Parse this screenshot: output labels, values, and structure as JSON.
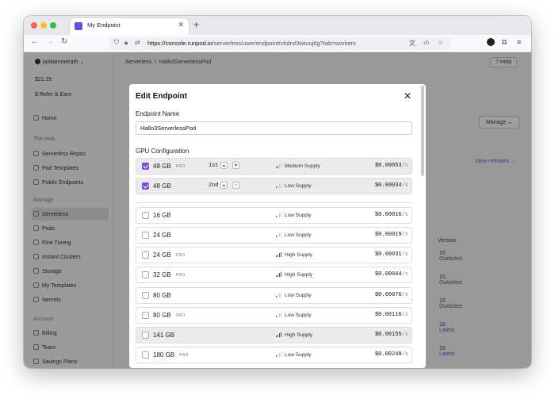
{
  "browser": {
    "tab_title": "My Endpoint",
    "url_domain": "https://console.runpod.io",
    "url_path": "/serverless/user/endpoint/vhdrvl3wtuuj6g?tab=workers"
  },
  "sidebar": {
    "user": "jankammerath",
    "balance": "$21.25",
    "refer": "Refer & Earn",
    "home": "Home",
    "hub_header": "The Hub",
    "hub_items": [
      "Serverless Repos",
      "Pod Templates",
      "Public Endpoints"
    ],
    "manage_header": "Manage",
    "manage_items": [
      "Serverless",
      "Pods",
      "Fine Tuning",
      "Instant Clusters",
      "Storage",
      "My Templates",
      "Secrets"
    ],
    "account_header": "Account",
    "account_items": [
      "Billing",
      "Team",
      "Savings Plans"
    ]
  },
  "background": {
    "breadcrumb_root": "Serverless",
    "breadcrumb_current": "Hallo3ServerlessPod",
    "help": "Help",
    "manage": "Manage",
    "view_releases": "View releases",
    "version_header": "Version",
    "rows": [
      {
        "version": "15",
        "status": "Outdated"
      },
      {
        "version": "15",
        "status": "Outdated"
      },
      {
        "version": "15",
        "status": "Outdated"
      },
      {
        "version": "16",
        "status": "Latest"
      },
      {
        "version": "16",
        "status": "Latest"
      }
    ]
  },
  "modal": {
    "title": "Edit Endpoint",
    "endpoint_name_label": "Endpoint Name",
    "endpoint_name_value": "Hallo3ServerlessPod",
    "gpu_config_label": "GPU Configuration",
    "selected_gpus": [
      {
        "memory": "48 GB",
        "pro": "PRO",
        "priority": "1st",
        "supply": "Medium Supply",
        "price": "$0.00053",
        "unit": "/s",
        "checked": true
      },
      {
        "memory": "48 GB",
        "pro": "",
        "priority": "2nd",
        "supply": "Low Supply",
        "price": "$0.00034",
        "unit": "/s",
        "checked": true
      }
    ],
    "available_gpus": [
      {
        "memory": "16 GB",
        "pro": "",
        "supply": "Low Supply",
        "price": "$0.00016",
        "unit": "/s"
      },
      {
        "memory": "24 GB",
        "pro": "",
        "supply": "Low Supply",
        "price": "$0.00019",
        "unit": "/s"
      },
      {
        "memory": "24 GB",
        "pro": "PRO",
        "supply": "High Supply",
        "price": "$0.00031",
        "unit": "/s"
      },
      {
        "memory": "32 GB",
        "pro": "PRO",
        "supply": "High Supply",
        "price": "$0.00044",
        "unit": "/s"
      },
      {
        "memory": "80 GB",
        "pro": "",
        "supply": "Low Supply",
        "price": "$0.00076",
        "unit": "/s"
      },
      {
        "memory": "80 GB",
        "pro": "PRO",
        "supply": "Low Supply",
        "price": "$0.00116",
        "unit": "/s"
      },
      {
        "memory": "141 GB",
        "pro": "",
        "supply": "High Supply",
        "price": "$0.00155",
        "unit": "/s"
      },
      {
        "memory": "180 GB",
        "pro": "PRO",
        "supply": "Low Supply",
        "price": "$0.00240",
        "unit": "/s"
      }
    ]
  },
  "colors": {
    "accent": "#7c4dd8",
    "overlay": "rgba(0,0,0,0.38)"
  }
}
